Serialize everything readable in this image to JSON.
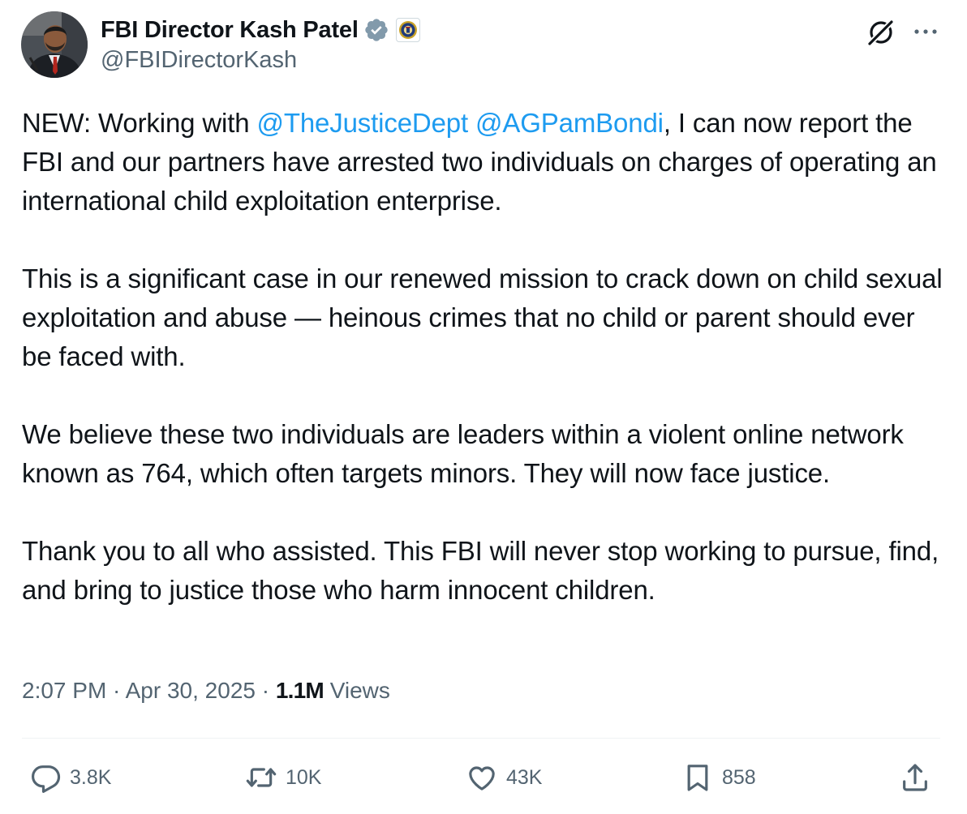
{
  "author": {
    "display_name": "FBI Director Kash Patel",
    "handle": "@FBIDirectorKash",
    "verified": true,
    "affiliate_badge": "fbi-seal-icon"
  },
  "header_icons": {
    "grok": "grok-icon",
    "more": "more-icon"
  },
  "tweet": {
    "p1_prefix": "NEW: Working with ",
    "mention_1": "@TheJusticeDept",
    "mention_separator": " ",
    "mention_2": "@AGPamBondi",
    "p1_suffix": ", I can now report the FBI and our partners have arrested two individuals on charges of operating an international child exploitation enterprise.",
    "p2": "This is a significant case in our renewed mission to crack down on child sexual exploitation and abuse — heinous crimes that no child or parent should ever be faced with.",
    "p3": "We believe these two individuals are leaders within a violent online network known as 764, which often targets minors. They will now face justice.",
    "p4": "Thank you to all who assisted. This FBI will never stop working to pursue, find, and bring to justice those who harm innocent children."
  },
  "meta": {
    "time": "2:07 PM",
    "separator_1": " · ",
    "date": "Apr 30, 2025",
    "separator_2": " · ",
    "views_count": "1.1M",
    "views_label": " Views"
  },
  "actions": {
    "replies": "3.8K",
    "reposts": "10K",
    "likes": "43K",
    "bookmarks": "858"
  },
  "colors": {
    "text": "#0f1419",
    "secondary": "#536471",
    "link": "#1d9bf0",
    "verified_badge": "#829aab",
    "divider": "#eff3f4"
  }
}
